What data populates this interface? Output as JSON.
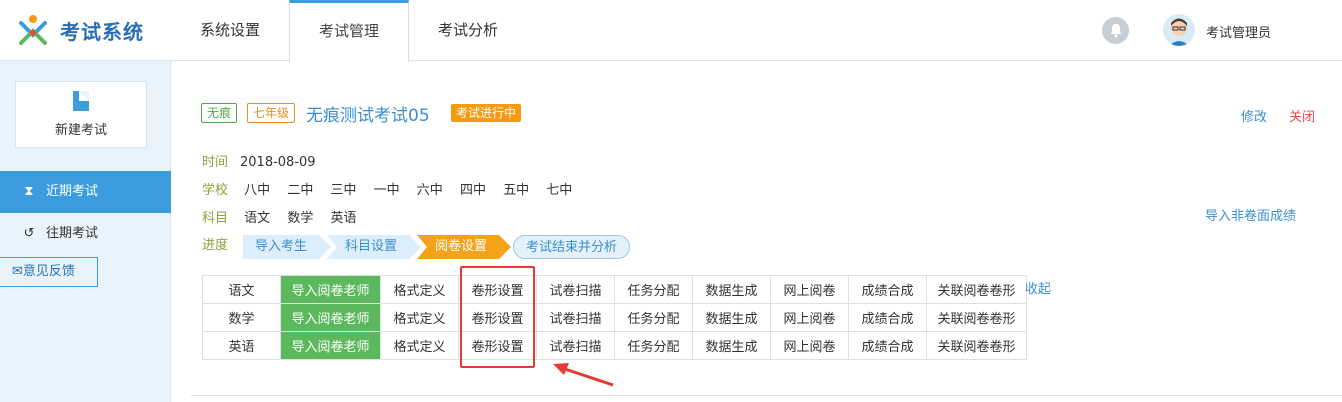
{
  "app": {
    "name": "考试系统"
  },
  "nav": {
    "items": [
      "系统设置",
      "考试管理",
      "考试分析"
    ],
    "active": "考试管理"
  },
  "user": {
    "name": "考试管理员"
  },
  "sidebar": {
    "new_exam": "新建考试",
    "items": [
      {
        "label": "近期考试",
        "icon": "hourglass-icon"
      },
      {
        "label": "往期考试",
        "icon": "history-icon"
      }
    ],
    "feedback": "意见反馈"
  },
  "exam": {
    "tags": [
      "无痕",
      "七年级"
    ],
    "title": "无痕测试考试05",
    "status": "考试进行中",
    "actions": {
      "edit": "修改",
      "close": "关闭"
    },
    "time_label": "时间",
    "time": "2018-08-09",
    "school_label": "学校",
    "schools": [
      "八中",
      "二中",
      "三中",
      "一中",
      "六中",
      "四中",
      "五中",
      "七中"
    ],
    "subject_label": "科目",
    "subjects": [
      "语文",
      "数学",
      "英语"
    ],
    "import_nonpaper": "导入非卷面成绩",
    "progress_label": "进度",
    "steps": [
      "导入考生",
      "科目设置",
      "阅卷设置",
      "考试结束并分析"
    ],
    "current_step": "阅卷设置"
  },
  "table": {
    "rows": [
      [
        "语文",
        "导入阅卷老师",
        "格式定义",
        "卷形设置",
        "试卷扫描",
        "任务分配",
        "数据生成",
        "网上阅卷",
        "成绩合成",
        "关联阅卷卷形"
      ],
      [
        "数学",
        "导入阅卷老师",
        "格式定义",
        "卷形设置",
        "试卷扫描",
        "任务分配",
        "数据生成",
        "网上阅卷",
        "成绩合成",
        "关联阅卷卷形"
      ],
      [
        "英语",
        "导入阅卷老师",
        "格式定义",
        "卷形设置",
        "试卷扫描",
        "任务分配",
        "数据生成",
        "网上阅卷",
        "成绩合成",
        "关联阅卷卷形"
      ]
    ],
    "collapse": "收起"
  },
  "colors": {
    "primary": "#3b9ddd",
    "green": "#5cb85c",
    "orange": "#f39c12",
    "red": "#e53935"
  }
}
